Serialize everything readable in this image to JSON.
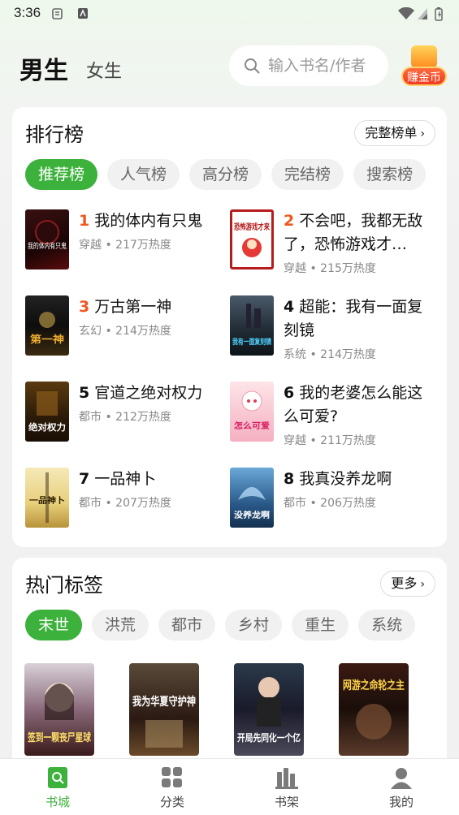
{
  "status_bar": {
    "time": "3:36"
  },
  "header": {
    "tab_male": "男生",
    "tab_female": "女生",
    "search_placeholder": "输入书名/作者",
    "earn_label": "赚金币"
  },
  "ranking": {
    "title": "排行榜",
    "more_label": "完整榜单",
    "chips": [
      "推荐榜",
      "人气榜",
      "高分榜",
      "完结榜",
      "搜索榜"
    ],
    "active_chip": "推荐榜",
    "items": [
      {
        "rank": "1",
        "title": "我的体内有只鬼",
        "meta": "穿越 • 217万热度",
        "cover_text": "我的体内有只鬼"
      },
      {
        "rank": "2",
        "title": "不会吧，我都无敌了，恐怖游戏才…",
        "meta": "穿越 • 215万热度",
        "cover_text": "恐怖游戏才来"
      },
      {
        "rank": "3",
        "title": "万古第一神",
        "meta": "玄幻 • 214万热度",
        "cover_text": "第一神"
      },
      {
        "rank": "4",
        "title": "超能：我有一面复刻镜",
        "meta": "系统 • 214万热度",
        "cover_text": "我有一面复刻镜"
      },
      {
        "rank": "5",
        "title": "官道之绝对权力",
        "meta": "都市 • 212万热度",
        "cover_text": "绝对权力"
      },
      {
        "rank": "6",
        "title": "我的老婆怎么能这么可爱?",
        "meta": "穿越 • 211万热度",
        "cover_text": "怎么可爱"
      },
      {
        "rank": "7",
        "title": "一品神卜",
        "meta": "都市 • 207万热度",
        "cover_text": "一品神卜"
      },
      {
        "rank": "8",
        "title": "我真没养龙啊",
        "meta": "都市 • 206万热度",
        "cover_text": "没养龙啊"
      }
    ]
  },
  "hot_tags": {
    "title": "热门标签",
    "more_label": "更多",
    "chips": [
      "末世",
      "洪荒",
      "都市",
      "乡村",
      "重生",
      "系统"
    ],
    "active_chip": "末世",
    "books": [
      {
        "cover_text": "签到一颗丧尸星球"
      },
      {
        "cover_text": "我为华夏守护神"
      },
      {
        "cover_text": "开局先同化一个亿"
      },
      {
        "cover_text": "网游之命轮之主"
      }
    ]
  },
  "bottom_nav": [
    {
      "label": "书城",
      "icon": "bookstore-icon",
      "active": true
    },
    {
      "label": "分类",
      "icon": "category-icon",
      "active": false
    },
    {
      "label": "书架",
      "icon": "bookshelf-icon",
      "active": false
    },
    {
      "label": "我的",
      "icon": "profile-icon",
      "active": false
    }
  ],
  "colors": {
    "accent": "#3cb13c",
    "rank_hot": "#f0561e"
  }
}
